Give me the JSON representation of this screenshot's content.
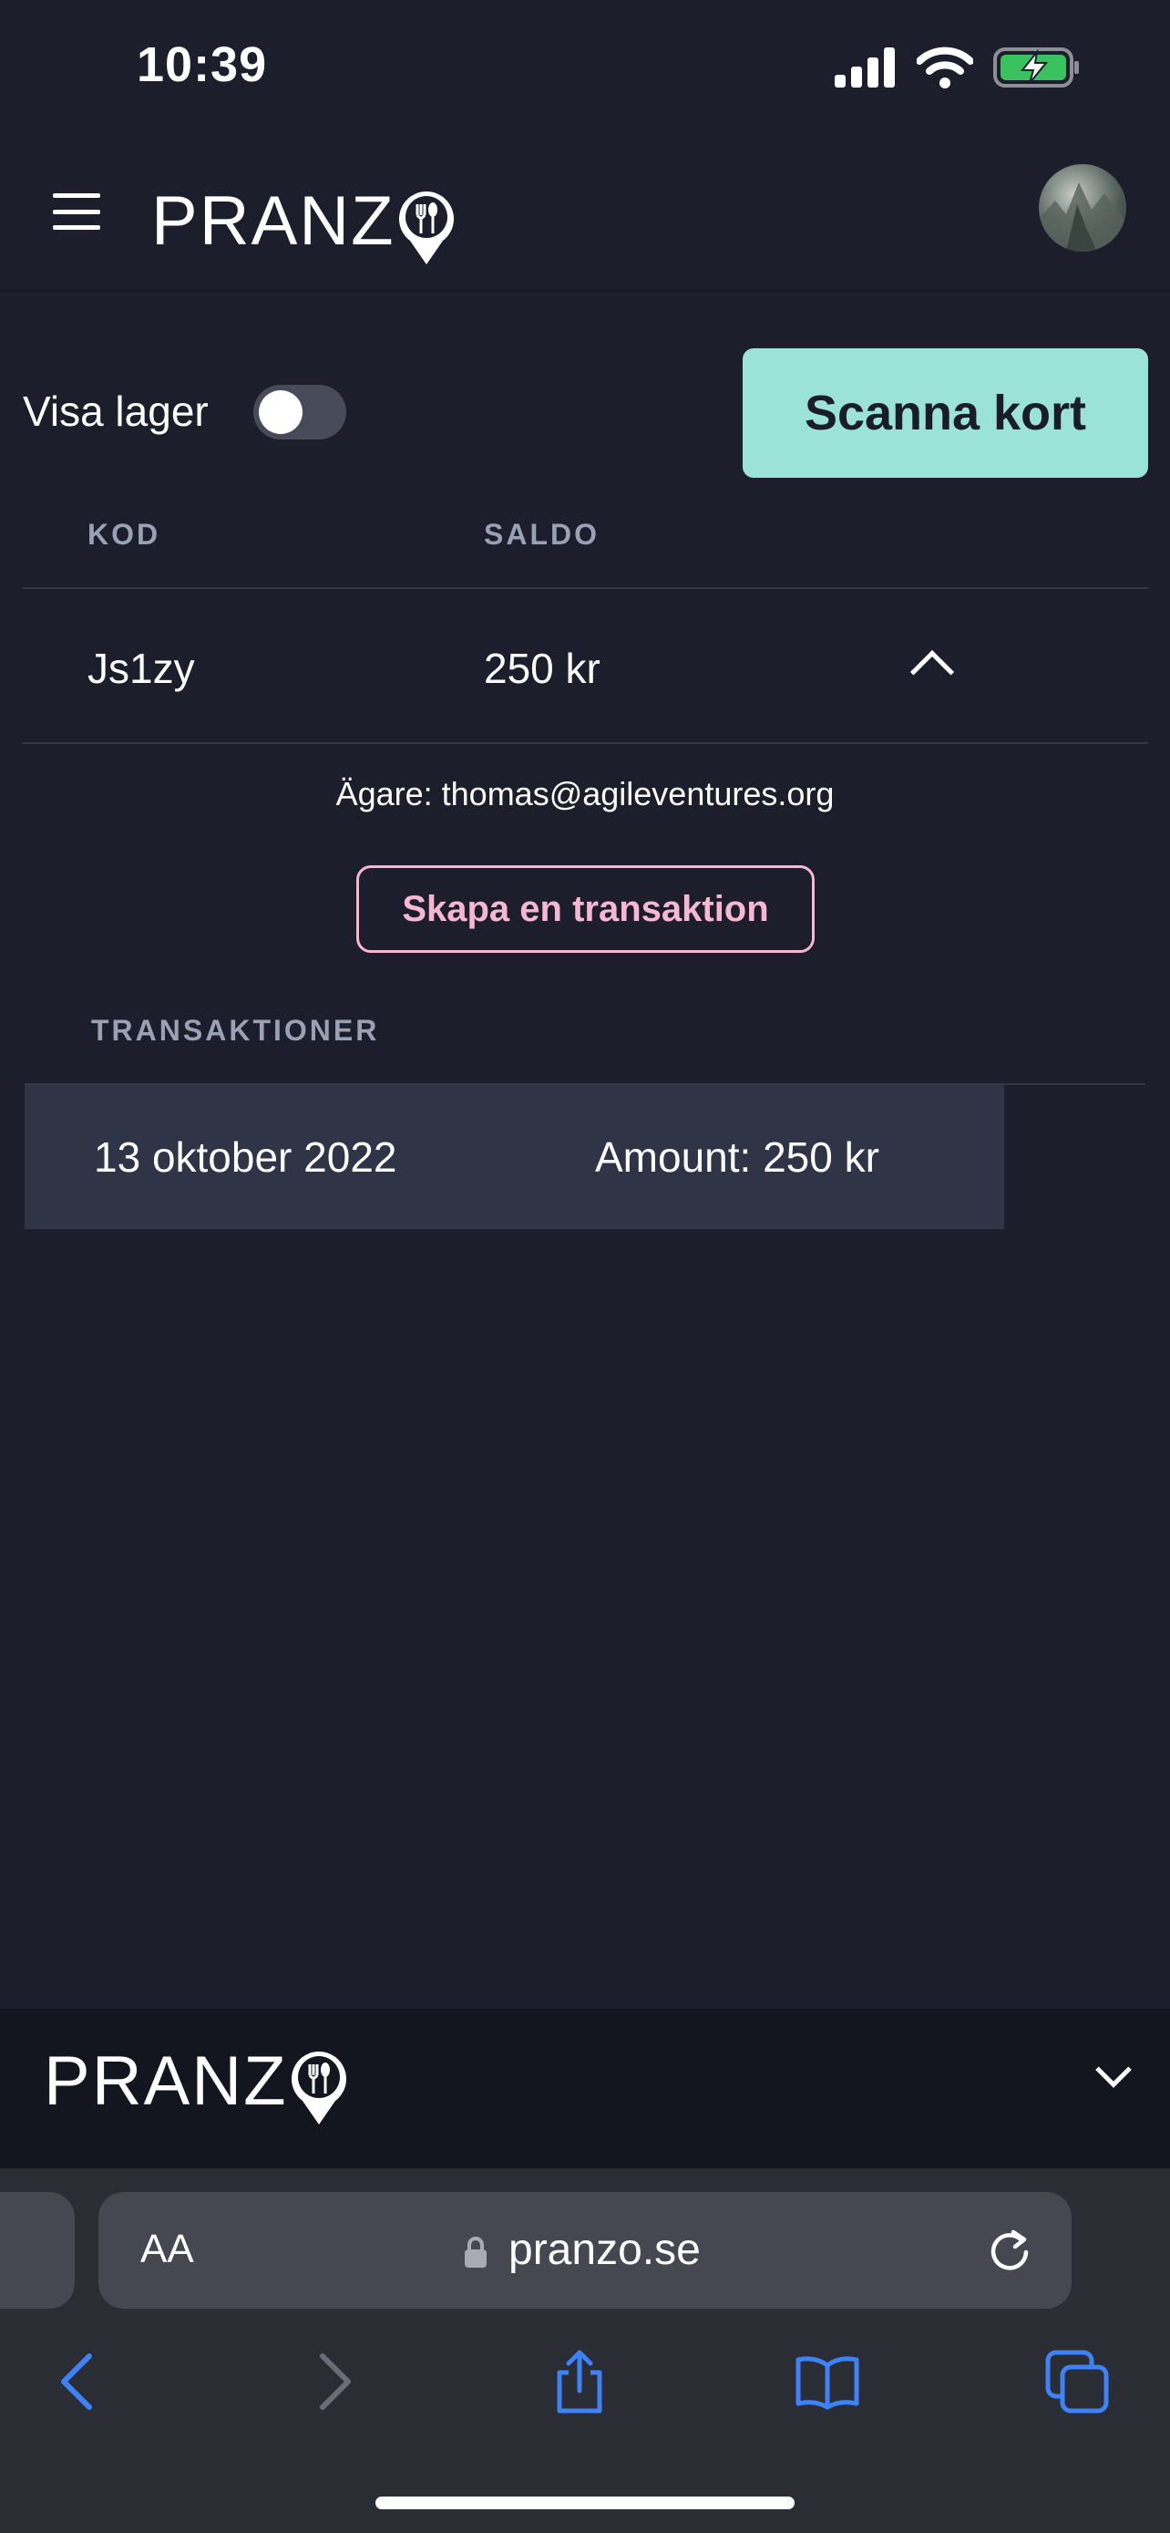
{
  "status_bar": {
    "time": "10:39"
  },
  "header": {
    "logo_text": "PRANZ"
  },
  "controls": {
    "toggle_label": "Visa lager",
    "toggle_on": false,
    "scan_button": "Scanna kort"
  },
  "table": {
    "headers": {
      "code": "KOD",
      "balance": "SALDO"
    },
    "row": {
      "code": "Js1zy",
      "balance": "250 kr"
    },
    "owner": "Ägare: thomas@agileventures.org",
    "create_button": "Skapa en transaktion",
    "transactions_header": "TRANSAKTIONER",
    "transactions": [
      {
        "date": "13 oktober 2022",
        "amount": "Amount: 250 kr"
      }
    ]
  },
  "footer": {
    "logo_text": "PRANZ"
  },
  "browser": {
    "text_size": "AA",
    "url": "pranzo.se"
  },
  "colors": {
    "background": "#1c1f2b",
    "accent": "#9be3d7",
    "pink": "#f7b7d3",
    "row_bg": "#2f3446"
  }
}
